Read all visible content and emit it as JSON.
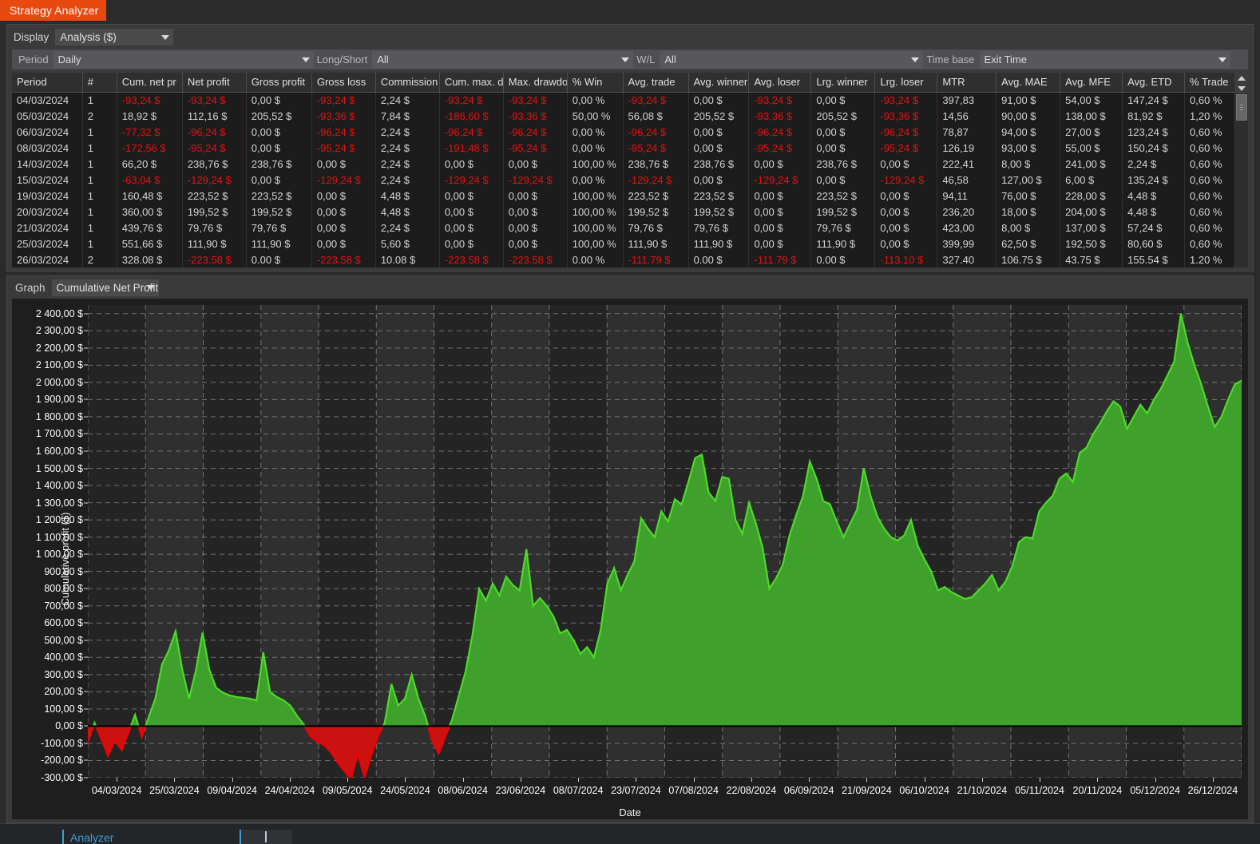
{
  "window": {
    "title": "Strategy Analyzer",
    "accent": "#e8490f"
  },
  "display": {
    "label": "Display",
    "value": "Analysis ($)"
  },
  "filters": [
    {
      "label": "Period",
      "value": "Daily"
    },
    {
      "label": "Long/Short",
      "value": "All"
    },
    {
      "label": "W/L",
      "value": "All"
    },
    {
      "label": "Time base",
      "value": "Exit Time"
    }
  ],
  "table": {
    "columns": [
      "Period",
      "#",
      "Cum. net pr",
      "Net profit",
      "Gross profit",
      "Gross loss",
      "Commission",
      "Cum. max. d",
      "Max. drawdo",
      "% Win",
      "Avg. trade",
      "Avg. winner",
      "Avg. loser",
      "Lrg. winner",
      "Lrg. loser",
      "MTR",
      "Avg. MAE",
      "Avg. MFE",
      "Avg. ETD",
      "% Trade"
    ],
    "rows": [
      [
        "04/03/2024",
        "1",
        "-93,24 $",
        "-93,24 $",
        "0,00 $",
        "-93,24 $",
        "2,24 $",
        "-93,24 $",
        "-93,24 $",
        "0,00 %",
        "-93,24 $",
        "0,00 $",
        "-93,24 $",
        "0,00 $",
        "-93,24 $",
        "397,83",
        "91,00 $",
        "54,00 $",
        "147,24 $",
        "0,60 %"
      ],
      [
        "05/03/2024",
        "2",
        "18,92 $",
        "112,16 $",
        "205,52 $",
        "-93,36 $",
        "7,84 $",
        "-186,60 $",
        "-93,36 $",
        "50,00 %",
        "56,08 $",
        "205,52 $",
        "-93,36 $",
        "205,52 $",
        "-93,36 $",
        "14,56",
        "90,00 $",
        "138,00 $",
        "81,92 $",
        "1,20 %"
      ],
      [
        "06/03/2024",
        "1",
        "-77,32 $",
        "-96,24 $",
        "0,00 $",
        "-96,24 $",
        "2,24 $",
        "-96,24 $",
        "-96,24 $",
        "0,00 %",
        "-96,24 $",
        "0,00 $",
        "-96,24 $",
        "0,00 $",
        "-96,24 $",
        "78,87",
        "94,00 $",
        "27,00 $",
        "123,24 $",
        "0,60 %"
      ],
      [
        "08/03/2024",
        "1",
        "-172,56 $",
        "-95,24 $",
        "0,00 $",
        "-95,24 $",
        "2,24 $",
        "-191,48 $",
        "-95,24 $",
        "0,00 %",
        "-95,24 $",
        "0,00 $",
        "-95,24 $",
        "0,00 $",
        "-95,24 $",
        "126,19",
        "93,00 $",
        "55,00 $",
        "150,24 $",
        "0,60 %"
      ],
      [
        "14/03/2024",
        "1",
        "66,20 $",
        "238,76 $",
        "238,76 $",
        "0,00 $",
        "2,24 $",
        "0,00 $",
        "0,00 $",
        "100,00 %",
        "238,76 $",
        "238,76 $",
        "0,00 $",
        "238,76 $",
        "0,00 $",
        "222,41",
        "8,00 $",
        "241,00 $",
        "2,24 $",
        "0,60 %"
      ],
      [
        "15/03/2024",
        "1",
        "-63,04 $",
        "-129,24 $",
        "0,00 $",
        "-129,24 $",
        "2,24 $",
        "-129,24 $",
        "-129,24 $",
        "0,00 %",
        "-129,24 $",
        "0,00 $",
        "-129,24 $",
        "0,00 $",
        "-129,24 $",
        "46,58",
        "127,00 $",
        "6,00 $",
        "135,24 $",
        "0,60 %"
      ],
      [
        "19/03/2024",
        "1",
        "160,48 $",
        "223,52 $",
        "223,52 $",
        "0,00 $",
        "4,48 $",
        "0,00 $",
        "0,00 $",
        "100,00 %",
        "223,52 $",
        "223,52 $",
        "0,00 $",
        "223,52 $",
        "0,00 $",
        "94,11",
        "76,00 $",
        "228,00 $",
        "4,48 $",
        "0,60 %"
      ],
      [
        "20/03/2024",
        "1",
        "360,00 $",
        "199,52 $",
        "199,52 $",
        "0,00 $",
        "4,48 $",
        "0,00 $",
        "0,00 $",
        "100,00 %",
        "199,52 $",
        "199,52 $",
        "0,00 $",
        "199,52 $",
        "0,00 $",
        "236,20",
        "18,00 $",
        "204,00 $",
        "4,48 $",
        "0,60 %"
      ],
      [
        "21/03/2024",
        "1",
        "439,76 $",
        "79,76 $",
        "79,76 $",
        "0,00 $",
        "2,24 $",
        "0,00 $",
        "0,00 $",
        "100,00 %",
        "79,76 $",
        "79,76 $",
        "0,00 $",
        "79,76 $",
        "0,00 $",
        "423,00",
        "8,00 $",
        "137,00 $",
        "57,24 $",
        "0,60 %"
      ],
      [
        "25/03/2024",
        "1",
        "551,66 $",
        "111,90 $",
        "111,90 $",
        "0,00 $",
        "5,60 $",
        "0,00 $",
        "0,00 $",
        "100,00 %",
        "111,90 $",
        "111,90 $",
        "0,00 $",
        "111,90 $",
        "0,00 $",
        "399,99",
        "62,50 $",
        "192,50 $",
        "80,60 $",
        "0,60 %"
      ],
      [
        "26/03/2024",
        "2",
        "328.08 $",
        "-223.58 $",
        "0.00 $",
        "-223.58 $",
        "10.08 $",
        "-223.58 $",
        "-223.58 $",
        "0.00 %",
        "-111.79 $",
        "0.00 $",
        "-111.79 $",
        "0.00 $",
        "-113.10 $",
        "327.40",
        "106.75 $",
        "43.75 $",
        "155.54 $",
        "1.20 %"
      ]
    ],
    "negative_cells": [
      [
        0,
        2
      ],
      [
        0,
        3
      ],
      [
        0,
        5
      ],
      [
        0,
        7
      ],
      [
        0,
        8
      ],
      [
        0,
        10
      ],
      [
        0,
        12
      ],
      [
        0,
        14
      ],
      [
        1,
        5
      ],
      [
        1,
        7
      ],
      [
        1,
        8
      ],
      [
        1,
        12
      ],
      [
        1,
        14
      ],
      [
        2,
        2
      ],
      [
        2,
        3
      ],
      [
        2,
        5
      ],
      [
        2,
        7
      ],
      [
        2,
        8
      ],
      [
        2,
        10
      ],
      [
        2,
        12
      ],
      [
        2,
        14
      ],
      [
        3,
        2
      ],
      [
        3,
        3
      ],
      [
        3,
        5
      ],
      [
        3,
        7
      ],
      [
        3,
        8
      ],
      [
        3,
        10
      ],
      [
        3,
        12
      ],
      [
        3,
        14
      ],
      [
        5,
        2
      ],
      [
        5,
        3
      ],
      [
        5,
        5
      ],
      [
        5,
        7
      ],
      [
        5,
        8
      ],
      [
        5,
        10
      ],
      [
        5,
        12
      ],
      [
        5,
        14
      ],
      [
        10,
        3
      ],
      [
        10,
        5
      ],
      [
        10,
        7
      ],
      [
        10,
        8
      ],
      [
        10,
        10
      ],
      [
        10,
        12
      ],
      [
        10,
        14
      ]
    ]
  },
  "graph": {
    "label": "Graph",
    "value": "Cumulative Net Profit"
  },
  "bottom": {
    "tab": "Analyzer"
  },
  "chart_data": {
    "type": "area",
    "title": "Cumulative Net Profit",
    "xlabel": "Date",
    "ylabel": "Cumulative profit ($)",
    "ylim": [
      -300,
      2450
    ],
    "ytick_step": 100,
    "yticks": [
      2400,
      2300,
      2200,
      2100,
      2000,
      1900,
      1800,
      1700,
      1600,
      1500,
      1400,
      1300,
      1200,
      1100,
      1000,
      900,
      800,
      700,
      600,
      500,
      400,
      300,
      200,
      100,
      0,
      -100,
      -200,
      -300
    ],
    "ytick_labels": [
      "2 400,00 $",
      "2 300,00 $",
      "2 200,00 $",
      "2 100,00 $",
      "2 000,00 $",
      "1 900,00 $",
      "1 800,00 $",
      "1 700,00 $",
      "1 600,00 $",
      "1 500,00 $",
      "1 400,00 $",
      "1 300,00 $",
      "1 200,00 $",
      "1 100,00 $",
      "1 000,00 $",
      "900,00 $",
      "800,00 $",
      "700,00 $",
      "600,00 $",
      "500,00 $",
      "400,00 $",
      "300,00 $",
      "200,00 $",
      "100,00 $",
      "0,00 $",
      "-100,00 $",
      "-200,00 $",
      "-300,00 $"
    ],
    "xtick_labels": [
      "04/03/2024",
      "25/03/2024",
      "09/04/2024",
      "24/04/2024",
      "09/05/2024",
      "24/05/2024",
      "08/06/2024",
      "23/06/2024",
      "08/07/2024",
      "23/07/2024",
      "07/08/2024",
      "22/08/2024",
      "06/09/2024",
      "21/09/2024",
      "06/10/2024",
      "21/10/2024",
      "05/11/2024",
      "20/11/2024",
      "05/12/2024",
      "26/12/2024"
    ],
    "grid": true,
    "legend": "none",
    "positive_color": "#3fa02c",
    "positive_line_color": "#4ddb2a",
    "negative_color": "#cc1111",
    "negative_line_color": "#f00000",
    "x_index_max": 212,
    "values": [
      -93,
      19,
      -77,
      -173,
      -80,
      -140,
      -40,
      66,
      -63,
      50,
      160,
      360,
      440,
      552,
      328,
      160,
      320,
      545,
      330,
      225,
      195,
      180,
      170,
      165,
      160,
      150,
      430,
      200,
      170,
      150,
      120,
      60,
      10,
      -60,
      -90,
      -110,
      -150,
      -210,
      -260,
      -310,
      -160,
      -300,
      -170,
      -60,
      20,
      245,
      120,
      160,
      300,
      160,
      60,
      -80,
      -160,
      -60,
      40,
      180,
      320,
      530,
      800,
      730,
      830,
      760,
      870,
      820,
      790,
      1030,
      700,
      745,
      700,
      640,
      540,
      560,
      500,
      420,
      460,
      400,
      560,
      830,
      920,
      790,
      880,
      960,
      1210,
      1150,
      1100,
      1250,
      1190,
      1320,
      1290,
      1420,
      1560,
      1580,
      1360,
      1310,
      1450,
      1440,
      1200,
      1120,
      1300,
      1180,
      1040,
      800,
      860,
      940,
      1110,
      1230,
      1340,
      1540,
      1440,
      1310,
      1290,
      1190,
      1100,
      1180,
      1260,
      1500,
      1340,
      1220,
      1150,
      1100,
      1080,
      1110,
      1200,
      1050,
      970,
      900,
      790,
      810,
      780,
      760,
      740,
      750,
      790,
      830,
      880,
      790,
      840,
      930,
      1070,
      1100,
      1090,
      1250,
      1300,
      1340,
      1440,
      1470,
      1420,
      1590,
      1620,
      1700,
      1760,
      1830,
      1890,
      1860,
      1730,
      1800,
      1870,
      1820,
      1900,
      1960,
      2040,
      2120,
      2400,
      2230,
      2100,
      1990,
      1860,
      1740,
      1800,
      1900,
      1990,
      2010
    ]
  }
}
